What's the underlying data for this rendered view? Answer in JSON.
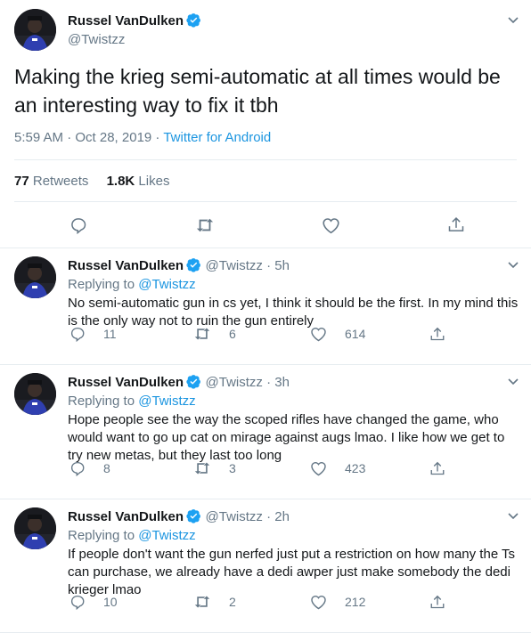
{
  "main_tweet": {
    "author_name": "Russel VanDulken",
    "handle": "@Twistzz",
    "text": "Making the krieg semi-automatic at all times would be an interesting way to fix it tbh",
    "timestamp": "5:59 AM · Oct 28, 2019 · ",
    "source": "Twitter for Android",
    "retweets_count": "77",
    "retweets_label": "Retweets",
    "likes_count": "1.8K",
    "likes_label": "Likes"
  },
  "replies": [
    {
      "author_name": "Russel VanDulken",
      "handle_time": "@Twistzz · 5h",
      "replying_prefix": "Replying to ",
      "replying_handle": "@Twistzz",
      "text": "No semi-automatic gun in cs yet, I think it should be the first. In my mind this is the only way not to ruin the gun entirely",
      "reply_count": "11",
      "retweet_count": "6",
      "like_count": "614"
    },
    {
      "author_name": "Russel VanDulken",
      "handle_time": "@Twistzz · 3h",
      "replying_prefix": "Replying to ",
      "replying_handle": "@Twistzz",
      "text": "Hope people see the way the scoped rifles have changed the game, who would want to go up cat on mirage against augs lmao. I like how we get to try new metas, but they last too long",
      "reply_count": "8",
      "retweet_count": "3",
      "like_count": "423"
    },
    {
      "author_name": "Russel VanDulken",
      "handle_time": "@Twistzz · 2h",
      "replying_prefix": "Replying to ",
      "replying_handle": "@Twistzz",
      "text": "If people don't want the gun nerfed just put a restriction on how many the Ts can purchase, we already have a dedi awper just make somebody the dedi krieger lmao",
      "reply_count": "10",
      "retweet_count": "2",
      "like_count": "212"
    }
  ],
  "colors": {
    "accent": "#1da1f2",
    "link": "#1b95e0",
    "muted": "#657786",
    "divider": "#e6ecf0"
  },
  "icons": [
    "chevron-down-icon",
    "verified-badge-icon",
    "reply-icon",
    "retweet-icon",
    "like-icon",
    "share-icon"
  ]
}
